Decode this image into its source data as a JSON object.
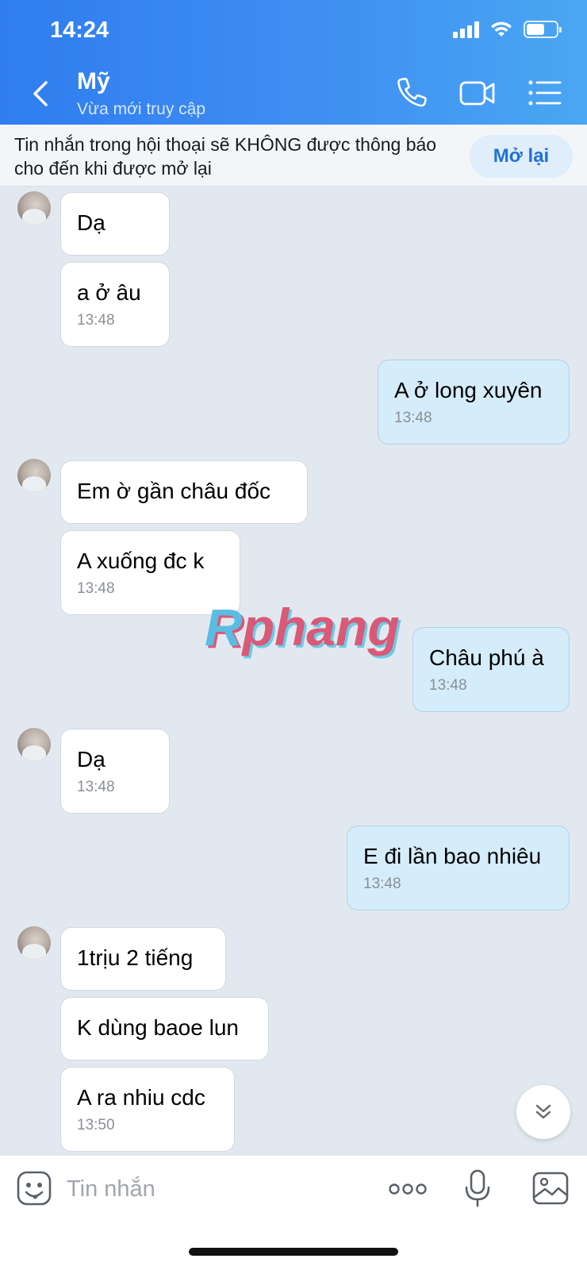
{
  "status_bar": {
    "time": "14:24"
  },
  "header": {
    "contact_name": "Mỹ",
    "contact_status": "Vừa mới truy cập",
    "icons": [
      "back-icon",
      "phone-icon",
      "video-call-icon",
      "menu-list-icon"
    ]
  },
  "banner": {
    "text": "Tin nhắn trong hội thoại sẽ KHÔNG được thông báo cho đến khi được mở lại",
    "button": "Mở lại"
  },
  "messages": [
    {
      "side": "in",
      "text": "Dạ",
      "time": ""
    },
    {
      "side": "in",
      "text": "a ở âu",
      "time": "13:48"
    },
    {
      "side": "out",
      "text": "A ở long xuyên",
      "time": "13:48"
    },
    {
      "side": "in",
      "text": "Em ờ gần châu đốc",
      "time": ""
    },
    {
      "side": "in",
      "text": "A xuống đc k",
      "time": "13:48"
    },
    {
      "side": "out",
      "text": "Châu phú à",
      "time": "13:48"
    },
    {
      "side": "in",
      "text": "Dạ",
      "time": "13:48"
    },
    {
      "side": "out",
      "text": "E đi lần bao nhiêu",
      "time": "13:48"
    },
    {
      "side": "in",
      "text": "1trịu 2 tiếng",
      "time": ""
    },
    {
      "side": "in",
      "text": "K dùng baoe lun",
      "time": ""
    },
    {
      "side": "in",
      "text": "A ra nhiu cdc",
      "time": "13:50"
    }
  ],
  "watermark": {
    "part1": "R",
    "part2": "phang"
  },
  "input_bar": {
    "placeholder": "Tin nhắn",
    "icons": [
      "sticker-icon",
      "more-options-icon",
      "microphone-icon",
      "image-icon"
    ]
  },
  "colors": {
    "header_start": "#2f7df0",
    "header_end": "#4aa7f2",
    "chat_background": "#e2e8f0",
    "incoming_bubble": "#ffffff",
    "outgoing_bubble": "#d5ecfb",
    "accent": "#1d72d8"
  }
}
